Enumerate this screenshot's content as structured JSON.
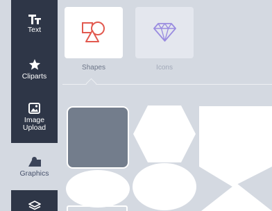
{
  "sidebar": {
    "items": [
      {
        "label": "Text",
        "icon": "text-icon"
      },
      {
        "label": "Cliparts",
        "icon": "star-icon"
      },
      {
        "label": "Image Upload",
        "label_line1": "Image",
        "label_line2": "Upload",
        "icon": "image-upload-icon"
      },
      {
        "label": "Graphics",
        "icon": "graphics-icon",
        "active": true
      },
      {
        "label": "",
        "icon": "layers-icon"
      }
    ]
  },
  "categories": [
    {
      "label": "Shapes",
      "icon": "shapes-icon",
      "selected": true
    },
    {
      "label": "Icons",
      "icon": "diamond-icon",
      "selected": false
    }
  ],
  "gallery": {
    "items": [
      "rounded-square",
      "hexagon",
      "pentagon-banner",
      "ellipse",
      "ellipse",
      "diamond"
    ]
  },
  "colors": {
    "rail": "#2e3647",
    "accent_red": "#e2594f",
    "accent_purple": "#9a8ce0",
    "panel": "#d4d9e1"
  }
}
